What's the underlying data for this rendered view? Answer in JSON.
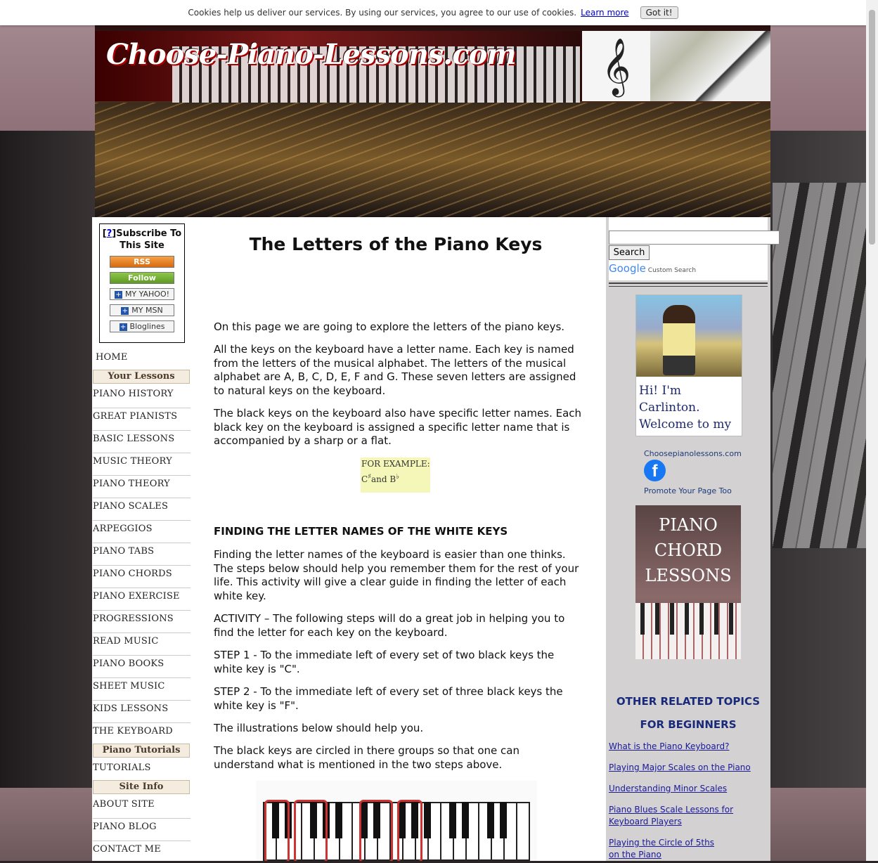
{
  "cookie": {
    "text": "Cookies help us deliver our services. By using our services, you agree to our use of cookies.",
    "learn_more": "Learn more",
    "got_it": "Got it!"
  },
  "header": {
    "site_title": "Choose-Piano-Lessons.com"
  },
  "subscribe": {
    "q": "?",
    "label": "Subscribe To This Site",
    "buttons": [
      "RSS",
      "Follow",
      "MY YAHOO!",
      "MY MSN",
      "Bloglines"
    ]
  },
  "nav": {
    "home": "HOME",
    "your_lessons": "Your Lessons",
    "lessons": [
      "PIANO HISTORY",
      "GREAT PIANISTS",
      "BASIC LESSONS",
      "MUSIC THEORY",
      "PIANO THEORY",
      "PIANO SCALES",
      "ARPEGGIOS",
      "PIANO TABS",
      "PIANO CHORDS",
      "PIANO EXERCISE",
      "PROGRESSIONS",
      "READ MUSIC",
      "PIANO BOOKS",
      "SHEET MUSIC",
      "KIDS LESSONS",
      "THE KEYBOARD"
    ],
    "tutorials_head": "Piano Tutorials",
    "tutorials": "TUTORIALS",
    "site_info_head": "Site Info",
    "site_info": [
      "ABOUT SITE",
      "PIANO BLOG",
      "CONTACT ME"
    ]
  },
  "main": {
    "title": "The Letters of the Piano Keys",
    "p1": "On this page we are going to explore the letters of the piano keys.",
    "p2": "All the keys on the keyboard have a letter name. Each key is named from the letters of the musical alphabet. The letters of the musical alphabet are A, B, C, D, E, F and G. These seven letters are assigned to natural keys on the keyboard.",
    "p3": "The black keys on the keyboard also have specific letter names. Each black key on the keyboard is assigned a specific letter name that is accompanied by a sharp or a flat.",
    "example_label": "FOR EXAMPLE:",
    "example_c": "C",
    "example_sharp": "♯",
    "example_and": "and B",
    "example_flat": "♭",
    "h2": "FINDING THE LETTER NAMES OF THE WHITE KEYS",
    "p4": "Finding the letter names of the keyboard is easier than one thinks. The steps below should help you remember them for the rest of your life. This activity will give a clear guide in finding the letter of each white key.",
    "p5": "ACTIVITY – The following steps will do a great job in helping you to find the letter for each key on the keyboard.",
    "p6": "STEP 1 - To the immediate left of every set of two black keys the white key is \"C\".",
    "p7": "STEP 2 - To the immediate left of every set of three black keys the white key is \"F\".",
    "p8": "The illustrations below should help you.",
    "p9": "The black keys are circled in there groups so that one can understand what is mentioned in the two steps above."
  },
  "right": {
    "search_button": "Search",
    "google": "Google",
    "custom_search": "Custom Search",
    "carlinton": "Hi! I'm Carlinton. Welcome to my website!",
    "fb_name": "Choosepianolessons.com",
    "fb_icon": "f",
    "promote": "Promote Your Page Too",
    "chord_ad": [
      "PIANO",
      "CHORD",
      "LESSONS"
    ],
    "related_1": "OTHER RELATED TOPICS",
    "related_2": "FOR BEGINNERS",
    "links": [
      "What is the Piano Keyboard?",
      "Playing Major Scales on the Piano",
      "Understanding Minor Scales",
      "Piano Blues Scale Lessons for Keyboard Players",
      "Playing the Circle of 5ths on the Piano"
    ]
  }
}
